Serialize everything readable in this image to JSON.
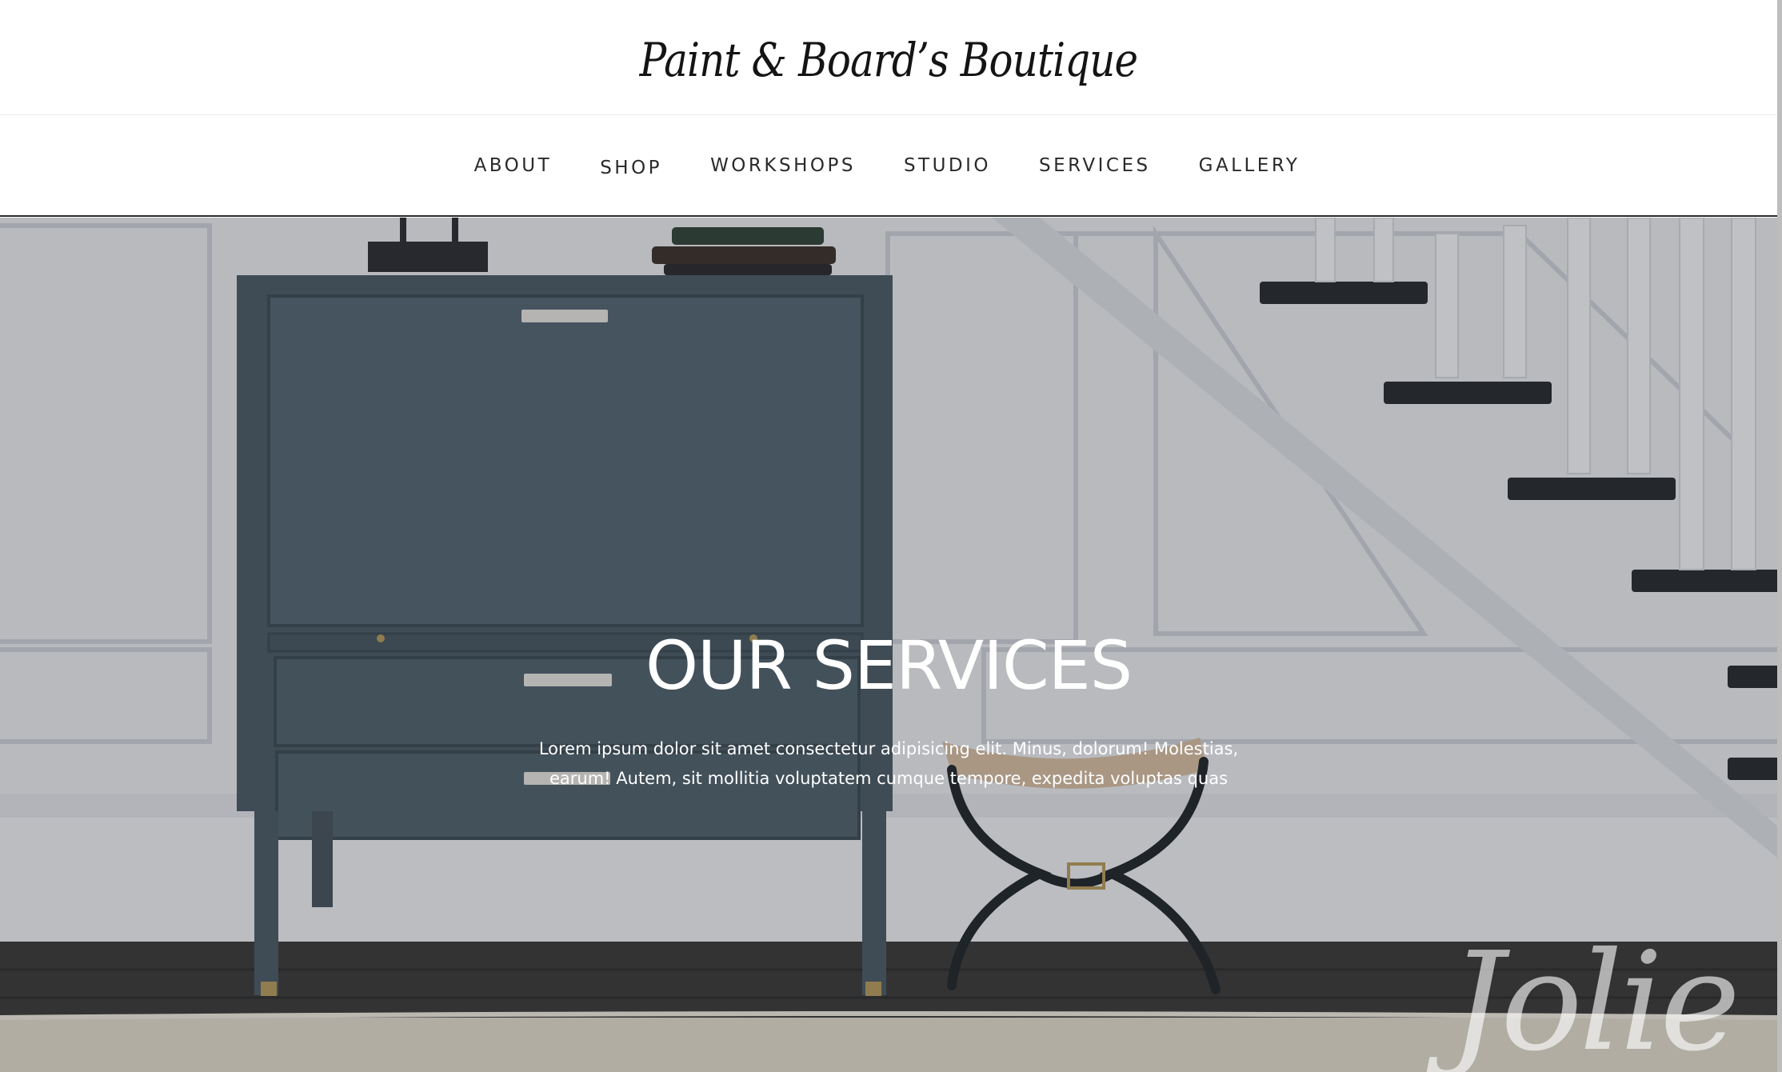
{
  "header": {
    "brand": "Paint & Board’s Boutique"
  },
  "nav": {
    "items": [
      {
        "label": "ABOUT"
      },
      {
        "label": "SHOP"
      },
      {
        "label": "WORKSHOPS"
      },
      {
        "label": "STUDIO"
      },
      {
        "label": "SERVICES"
      },
      {
        "label": "GALLERY"
      }
    ]
  },
  "hero": {
    "title": "OUR SERVICES",
    "text": "Lorem ipsum dolor sit amet consectetur adipisicing elit. Minus, dolorum! Molestias, earum! Autem, sit mollitia voluptatem cumque tempore, expedita voluptas quas",
    "watermark": "Jolie"
  },
  "colors": {
    "cabinet": "#4a5a64",
    "wall": "#eceef1",
    "floor": "#3a3836",
    "rug": "#e3dccb",
    "stair_tread": "#232628"
  }
}
